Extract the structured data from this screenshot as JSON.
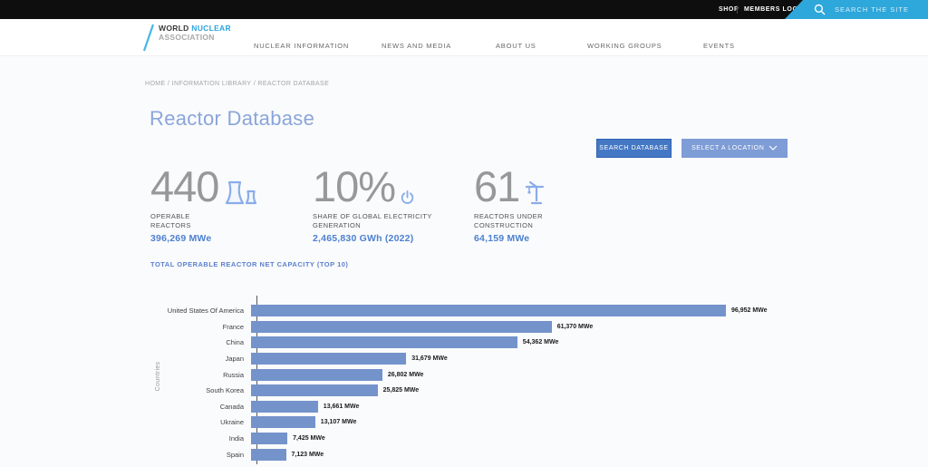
{
  "topbar": {
    "shop_label": "SHOP",
    "members_login_label": "MEMBERS LOGIN",
    "search_placeholder": "SEARCH THE SITE"
  },
  "logo": {
    "word1": "WORLD",
    "word2": "NUCLEAR",
    "line2": "ASSOCIATION"
  },
  "nav": {
    "items": [
      {
        "label": "NUCLEAR INFORMATION"
      },
      {
        "label": "NEWS AND MEDIA"
      },
      {
        "label": "ABOUT US"
      },
      {
        "label": "WORKING GROUPS"
      },
      {
        "label": "EVENTS"
      }
    ]
  },
  "breadcrumb": {
    "text": "HOME / INFORMATION LIBRARY / REACTOR DATABASE"
  },
  "page": {
    "title": "Reactor Database"
  },
  "actions": {
    "search_database_label": "SEARCH DATABASE",
    "select_location_label": "SELECT A LOCATION"
  },
  "stats": {
    "items": [
      {
        "value": "440",
        "icon": "cooling-towers-icon",
        "label": "OPERABLE REACTORS",
        "metric": "396,269 MWe"
      },
      {
        "value": "10%",
        "icon": "power-icon",
        "label": "SHARE OF GLOBAL ELECTRICITY GENERATION",
        "metric": "2,465,830 GWh (2022)"
      },
      {
        "value": "61",
        "icon": "crane-icon",
        "label": "REACTORS UNDER CONSTRUCTION",
        "metric": "64,159 MWe"
      }
    ]
  },
  "chart_data": {
    "type": "bar",
    "orientation": "horizontal",
    "title": "TOTAL OPERABLE REACTOR NET CAPACITY (TOP 10)",
    "ylabel": "Countries",
    "xlabel": "",
    "categories": [
      "United States Of America",
      "France",
      "China",
      "Japan",
      "Russia",
      "South Korea",
      "Canada",
      "Ukraine",
      "India",
      "Spain"
    ],
    "values": [
      96952,
      61370,
      54362,
      31679,
      26802,
      25825,
      13661,
      13107,
      7425,
      7123
    ],
    "value_labels": [
      "96,952 MWe",
      "61,370 MWe",
      "54,362 MWe",
      "31,679 MWe",
      "26,802 MWe",
      "25,825 MWe",
      "13,661 MWe",
      "13,107 MWe",
      "7,425 MWe",
      "7,123 MWe"
    ],
    "unit": "MWe",
    "xlim": [
      0,
      96952
    ],
    "grid": false,
    "legend": false,
    "bar_color": "#7493cb"
  },
  "colors": {
    "accent_blue": "#2ea7db",
    "link_blue": "#4d81d1",
    "title_blue": "#8aa5da",
    "bar_blue": "#7493cb",
    "button_primary": "#4478c4",
    "button_secondary": "#7e9cd6",
    "topbar_black": "#0e0e0e"
  }
}
